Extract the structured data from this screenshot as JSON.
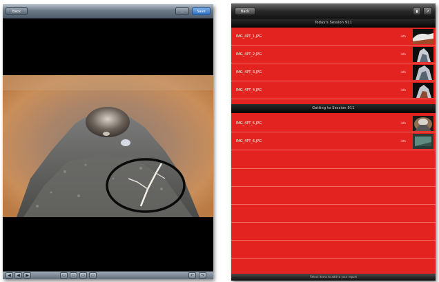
{
  "left_panel": {
    "top_bar": {
      "back_label": "Back",
      "mid_label": "...",
      "action_label": "Save"
    },
    "toolbar": {
      "buttons": [
        "◀",
        "◀",
        "▶",
        "▭",
        "▭",
        "▭",
        "▭",
        "↶",
        "↷"
      ]
    }
  },
  "right_panel": {
    "top_bar": {
      "back_label": "Back",
      "btn1_label": "▮",
      "btn2_label": "↗"
    },
    "sections": [
      {
        "header": "Today's Session 911",
        "items": [
          {
            "name": "IMG_4PT_1.JPG",
            "meta": "info"
          },
          {
            "name": "IMG_4PT_2.JPG",
            "meta": "info"
          },
          {
            "name": "IMG_4PT_3.JPG",
            "meta": "info"
          },
          {
            "name": "IMG_4PT_4.JPG",
            "meta": "info"
          }
        ]
      },
      {
        "header": "Getting to Session 911",
        "items": [
          {
            "name": "IMG_4PT_5.JPG",
            "meta": "info"
          },
          {
            "name": "IMG_4PT_6.JPG",
            "meta": "info"
          }
        ]
      }
    ],
    "footer_label": "Select items to add to your report"
  },
  "colors": {
    "list_red": "#e3231f",
    "row_divider": "#f56b63",
    "ios_blue": "#2f6fc2"
  }
}
